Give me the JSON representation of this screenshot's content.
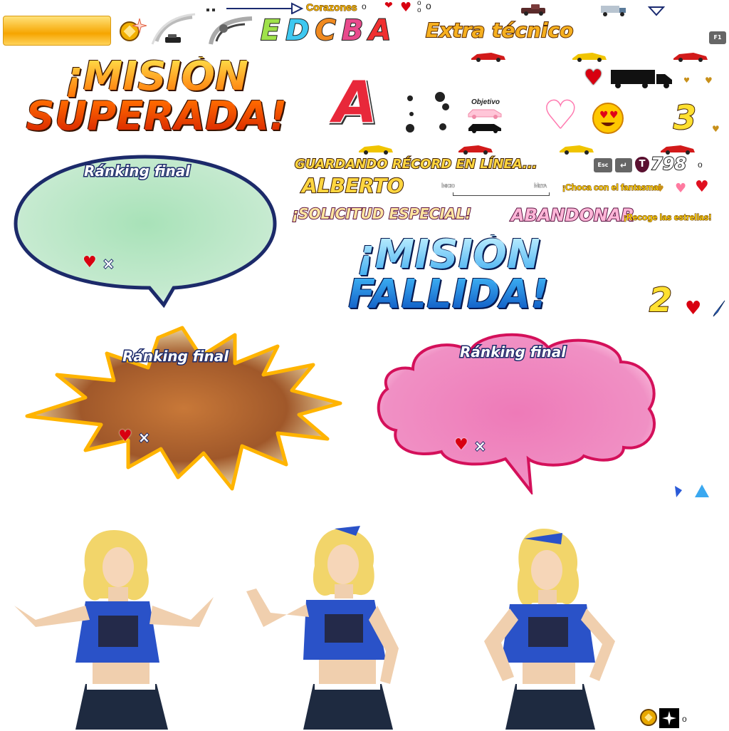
{
  "hud": {
    "hearts_label": "Corazones",
    "hearts_degree": "o",
    "hearts_x": "x",
    "hearts_o": "o",
    "grades": [
      "E",
      "D",
      "C",
      "B",
      "A"
    ],
    "grade_colors": [
      "#9fe24a",
      "#3ec8f0",
      "#f08a20",
      "#e84a8c",
      "#f03030"
    ],
    "extra_label": "Extra técnico",
    "f1_key": "F1"
  },
  "mission": {
    "success_line1": "¡MISIÓN",
    "success_line2": "SUPERADA!",
    "failed_line1": "¡MISIÓN",
    "failed_line2": "FALLIDA!"
  },
  "rank_big": "A",
  "objective_label": "Objetivo",
  "number_three": "3",
  "number_two": "2",
  "banners": {
    "saving": "GUARDANDO RÉCORD EN LÍNEA...",
    "player_name": "ALBERTO",
    "special_request": "¡SOLICITUD ESPECIAL!",
    "abandon": "ABANDONAR",
    "crash_ghost": "¡Choca con el fantasma!",
    "collect_stars": "¡Recoge las estrellas!"
  },
  "progress": {
    "start_label": "Inicio",
    "goal_label": "Meta"
  },
  "keys": {
    "esc": "Esc",
    "enter": "↵",
    "t_badge": "T"
  },
  "timer_value": "798",
  "timer_suffix": "o",
  "bubbles": {
    "green": {
      "title": "Ránking final",
      "x": "×"
    },
    "star": {
      "title": "Ránking final",
      "x": "×"
    },
    "pink": {
      "title": "Ránking final",
      "x": "×"
    }
  },
  "coin_suffix": "o",
  "colors": {
    "gold": "#f6a500",
    "green_bubble": "#b7e6c2",
    "pink_bubble": "#ee7ab8",
    "brown_star": "#a05a2c",
    "navy_outline": "#1c2a6a",
    "heart_red": "#d80010"
  }
}
